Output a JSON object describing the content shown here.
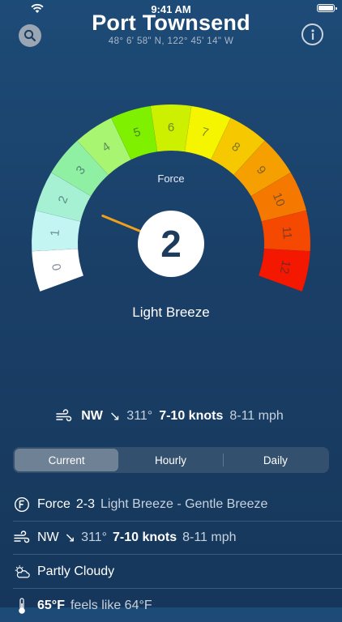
{
  "status": {
    "time": "9:41 AM"
  },
  "header": {
    "title": "Port Townsend",
    "coords": "48° 6' 58\" N, 122° 45' 14\" W"
  },
  "icons": {
    "search": "search-icon",
    "info": "info-icon",
    "wind": "wind-icon",
    "force": "force-icon",
    "cloud": "partly-cloudy-icon",
    "thermometer": "thermometer-icon"
  },
  "gauge": {
    "label": "Force",
    "value": "2",
    "needle_value": 2,
    "description": "Light Breeze",
    "scale": [
      "0",
      "1",
      "2",
      "3",
      "4",
      "5",
      "6",
      "7",
      "8",
      "9",
      "10",
      "11",
      "12"
    ],
    "colors": [
      "#ffffff",
      "#c3f5f3",
      "#a6f0d3",
      "#8ff0a4",
      "#a8f572",
      "#7ef000",
      "#ccf000",
      "#f5f500",
      "#f5c800",
      "#f5a000",
      "#f57800",
      "#f54800",
      "#f51800"
    ],
    "needle_color": "#f0a11c"
  },
  "summary": {
    "direction": "NW",
    "arrow": "↘",
    "degrees": "311°",
    "knots": "7-10 knots",
    "mph": "8-11 mph"
  },
  "tabs": [
    "Current",
    "Hourly",
    "Daily"
  ],
  "details": {
    "force_title": "Force",
    "force_range": "2-3",
    "force_desc": "Light Breeze - Gentle Breeze",
    "wind_dir": "NW",
    "wind_arrow": "↘",
    "wind_deg": "311°",
    "wind_knots": "7-10 knots",
    "wind_mph": "8-11 mph",
    "sky": "Partly Cloudy",
    "temp": "65°F",
    "feels": "feels like 64°F"
  }
}
